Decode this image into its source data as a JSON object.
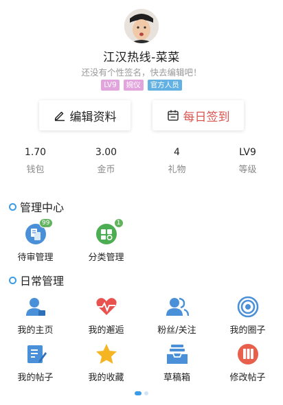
{
  "profile": {
    "username": "江汉热线-菜菜",
    "signature": "还没有个性签名，快去编辑吧！",
    "badges": [
      "LV9",
      "婉仪",
      "官方人员"
    ]
  },
  "actions": {
    "edit_label": "编辑资料",
    "checkin_label": "每日签到"
  },
  "stats": [
    {
      "value": "1.70",
      "label": "钱包"
    },
    {
      "value": "3.00",
      "label": "金币"
    },
    {
      "value": "4",
      "label": "礼物"
    },
    {
      "value": "LV9",
      "label": "等级"
    }
  ],
  "admin": {
    "title": "管理中心",
    "items": [
      {
        "label": "待审管理",
        "icon": "pending-review-icon",
        "badge": "99"
      },
      {
        "label": "分类管理",
        "icon": "category-manage-icon",
        "badge": "1"
      }
    ]
  },
  "daily": {
    "title": "日常管理",
    "items": [
      {
        "label": "我的主页",
        "icon": "user-home-icon"
      },
      {
        "label": "我的邂逅",
        "icon": "heart-pulse-icon"
      },
      {
        "label": "粉丝/关注",
        "icon": "fans-icon"
      },
      {
        "label": "我的圈子",
        "icon": "circle-target-icon"
      },
      {
        "label": "我的帖子",
        "icon": "post-edit-icon"
      },
      {
        "label": "我的收藏",
        "icon": "star-icon"
      },
      {
        "label": "草稿箱",
        "icon": "draft-tray-icon"
      },
      {
        "label": "修改帖子",
        "icon": "modify-post-icon"
      }
    ]
  },
  "colors": {
    "accent": "#3b9be6",
    "checkin": "#d9534f",
    "badge_pink": "#e2a4dc",
    "badge_blue": "#63b0e2"
  }
}
